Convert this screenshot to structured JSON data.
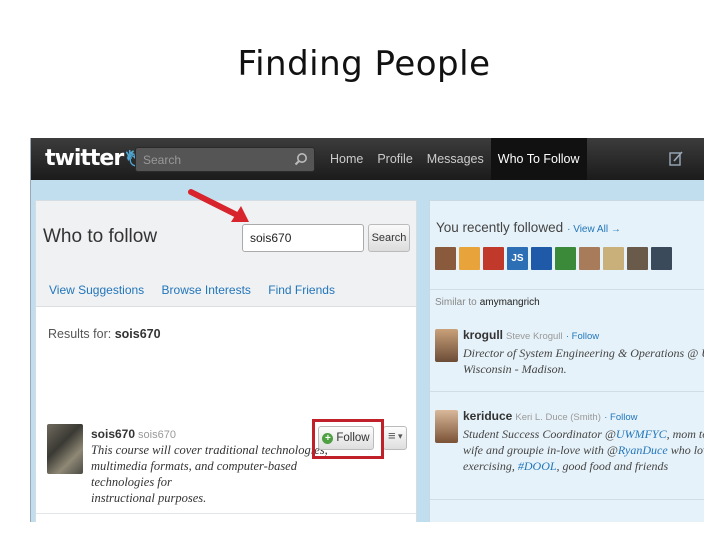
{
  "slide": {
    "title": "Finding People"
  },
  "topbar": {
    "logo": "twitter",
    "search_placeholder": "Search",
    "nav": [
      "Home",
      "Profile",
      "Messages",
      "Who To Follow"
    ]
  },
  "who_to_follow": {
    "title": "Who to follow",
    "search_value": "sois670",
    "search_button": "Search",
    "tabs": [
      "View Suggestions",
      "Browse Interests",
      "Find Friends"
    ],
    "results_prefix": "Results for:",
    "results_query": "sois670",
    "result": {
      "name": "sois670",
      "handle": "sois670",
      "bio": [
        "This course will cover traditional technologies,",
        "multimedia formats, and computer-based technologies for",
        "instructional purposes."
      ],
      "follow_label": "Follow"
    }
  },
  "recent": {
    "title": "You recently followed",
    "view_all": "· View All →",
    "avatars": [
      {
        "color": "#8a5a3c",
        "text": ""
      },
      {
        "color": "#e8a33b",
        "text": ""
      },
      {
        "color": "#c0392b",
        "text": ""
      },
      {
        "color": "#2c6fb5",
        "text": "JS"
      },
      {
        "color": "#1e5aa8",
        "text": ""
      },
      {
        "color": "#3b8a3a",
        "text": ""
      },
      {
        "color": "#a87b5a",
        "text": ""
      },
      {
        "color": "#c9b07a",
        "text": ""
      },
      {
        "color": "#6a5a4a",
        "text": ""
      },
      {
        "color": "#3a4a5a",
        "text": ""
      }
    ],
    "similar_prefix": "Similar to",
    "similar_user": "amymangrich",
    "suggestions": [
      {
        "name": "krogull",
        "real_name": "Steve Krogull",
        "follow": "· Follow",
        "bio": [
          "Director of System Engineering & Operations @ Univer",
          "Wisconsin - Madison."
        ]
      },
      {
        "name": "keriduce",
        "real_name": "Keri L. Duce (Smith)",
        "follow": "· Follow",
        "bio_line1_pre": "Student Success Coordinator @",
        "bio_line1_link": "UWMFYC",
        "bio_line1_post": ", mom to Wy",
        "bio_line2_pre": "wife and groupie in-love with @",
        "bio_line2_link": "RyanDuce",
        "bio_line2_post": " who loves p",
        "bio_line3_pre": "exercising, ",
        "bio_line3_link": "#DOOL",
        "bio_line3_post": ", good food and friends"
      }
    ]
  }
}
